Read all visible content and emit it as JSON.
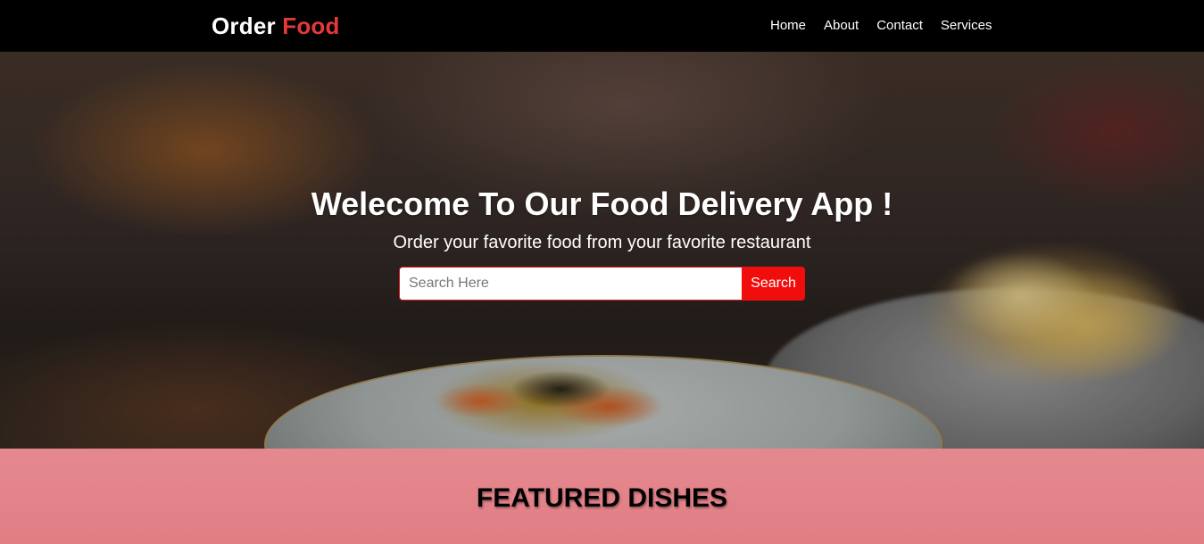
{
  "navbar": {
    "brand_part1": "Order",
    "brand_part2": "Food",
    "links": [
      "Home",
      "About",
      "Contact",
      "Services"
    ]
  },
  "hero": {
    "title": "Welecome To Our Food Delivery App !",
    "subtitle": "Order your favorite food from your favorite restaurant",
    "search": {
      "placeholder": "Search Here",
      "value": "",
      "button_label": "Search"
    }
  },
  "featured": {
    "title": "FEATURED DISHES"
  },
  "colors": {
    "navbar_bg": "#000000",
    "brand_accent": "#e53939",
    "search_button": "#f20d0d",
    "featured_bg": "#e5898f"
  }
}
